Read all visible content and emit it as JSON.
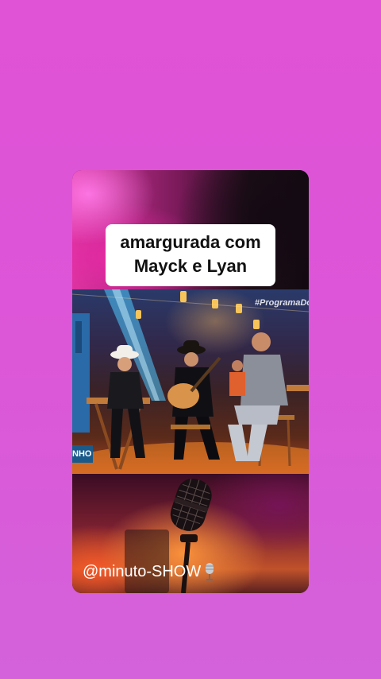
{
  "caption": {
    "line1": "amargurada com",
    "line2": "Mayck e Lyan"
  },
  "video": {
    "hashtag": "#ProgramaDo",
    "banner_text": "NHO"
  },
  "footer": {
    "handle": "@minuto-SHOW",
    "icon": "microphone-icon"
  },
  "colors": {
    "background": "#e052d6",
    "caption_bg": "#ffffff",
    "caption_text": "#111111",
    "handle_text": "#ffffff"
  }
}
